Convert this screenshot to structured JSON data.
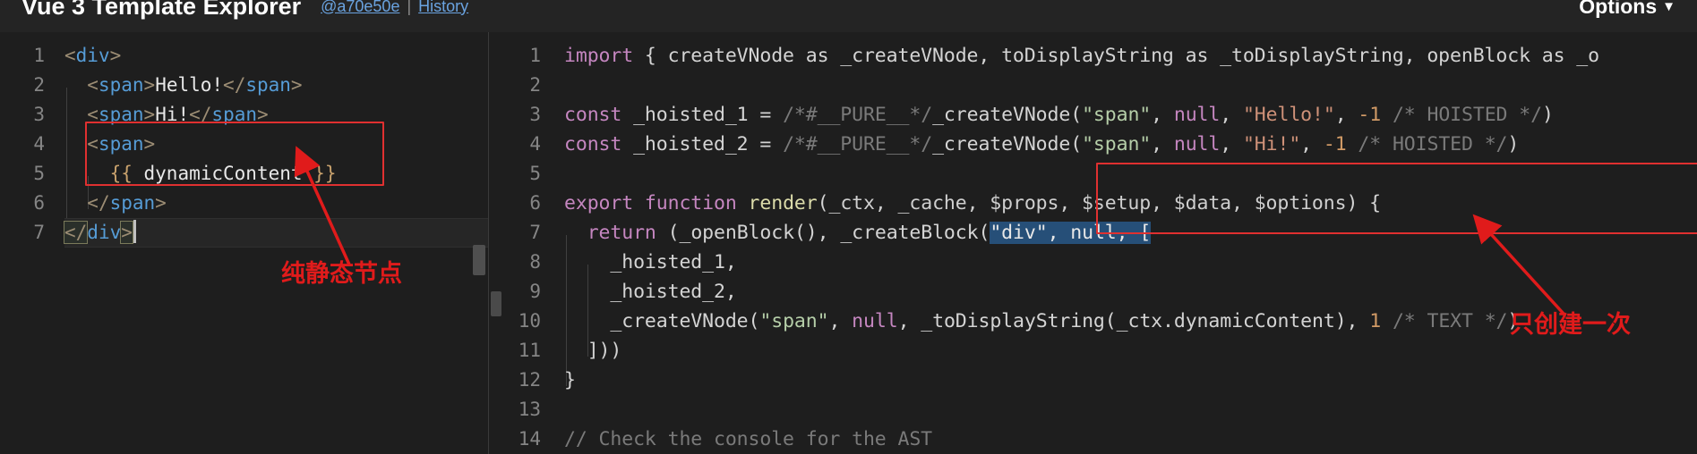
{
  "header": {
    "title": "Vue 3 Template Explorer",
    "commit_link": "@a70e50e",
    "separator": "|",
    "history_link": "History",
    "options_label": "Options",
    "options_caret": "▼"
  },
  "left_editor": {
    "name": "template-editor",
    "lines": [
      {
        "num": "1",
        "text": "<div>"
      },
      {
        "num": "2",
        "text": "  <span>Hello!</span>"
      },
      {
        "num": "3",
        "text": "  <span>Hi!</span>"
      },
      {
        "num": "4",
        "text": "  <span>"
      },
      {
        "num": "5",
        "text": "    {{ dynamicContent }}"
      },
      {
        "num": "6",
        "text": "  </span>"
      },
      {
        "num": "7",
        "text": "</div>"
      }
    ]
  },
  "right_editor": {
    "name": "output-editor",
    "lines": [
      {
        "num": "1",
        "text": "import { createVNode as _createVNode, toDisplayString as _toDisplayString, openBlock as _o"
      },
      {
        "num": "2",
        "text": ""
      },
      {
        "num": "3",
        "text": "const _hoisted_1 = /*#__PURE__*/_createVNode(\"span\", null, \"Hello!\", -1 /* HOISTED */)"
      },
      {
        "num": "4",
        "text": "const _hoisted_2 = /*#__PURE__*/_createVNode(\"span\", null, \"Hi!\", -1 /* HOISTED */)"
      },
      {
        "num": "5",
        "text": ""
      },
      {
        "num": "6",
        "text": "export function render(_ctx, _cache, $props, $setup, $data, $options) {"
      },
      {
        "num": "7",
        "text": "  return (_openBlock(), _createBlock(\"div\", null, ["
      },
      {
        "num": "8",
        "text": "    _hoisted_1,"
      },
      {
        "num": "9",
        "text": "    _hoisted_2,"
      },
      {
        "num": "10",
        "text": "    _createVNode(\"span\", null, _toDisplayString(_ctx.dynamicContent), 1 /* TEXT */)"
      },
      {
        "num": "11",
        "text": "  ]))"
      },
      {
        "num": "12",
        "text": "}"
      },
      {
        "num": "13",
        "text": ""
      },
      {
        "num": "14",
        "text": "// Check the console for the AST"
      }
    ]
  },
  "annotations": {
    "left_label": "纯静态节点",
    "right_label": "只创建一次",
    "highlight_color": "#e01b1b"
  },
  "tokens": {
    "l1_lt": "<",
    "l1_tag": "div",
    "l1_gt": ">",
    "l2_ind": "  ",
    "l2_lt": "<",
    "l2_tag": "span",
    "l2_gt": ">",
    "l2_txt": "Hello!",
    "l2_lt2": "</",
    "l2_tag2": "span",
    "l2_gt2": ">",
    "l3_ind": "  ",
    "l3_lt": "<",
    "l3_tag": "span",
    "l3_gt": ">",
    "l3_txt": "Hi!",
    "l3_lt2": "</",
    "l3_tag2": "span",
    "l3_gt2": ">",
    "l4_ind": "  ",
    "l4_lt": "<",
    "l4_tag": "span",
    "l4_gt": ">",
    "l5_ind": "    ",
    "l5_open": "{{",
    "l5_expr": " dynamicContent ",
    "l5_close": "}}",
    "l6_ind": "  ",
    "l6_lt": "</",
    "l6_tag": "span",
    "l6_gt": ">",
    "l7_lt": "</",
    "l7_tag": "div",
    "l7_gt": ">",
    "r1_kw": "import",
    "r1_rest": " { createVNode as _createVNode, toDisplayString as _toDisplayString, openBlock as _o",
    "r3_kw": "const",
    "r3_name": " _hoisted_1 ",
    "r3_eq": "= ",
    "r3_pure": "/*#__PURE__*/",
    "r3_fn": "_createVNode",
    "r3_p1": "(",
    "r3_s1": "\"span\"",
    "r3_c1": ", ",
    "r3_null": "null",
    "r3_c2": ", ",
    "r3_s2": "\"Hello!\"",
    "r3_c3": ", ",
    "r3_num": "-1",
    "r3_com": " /* HOISTED */",
    "r3_p2": ")",
    "r4_kw": "const",
    "r4_name": " _hoisted_2 ",
    "r4_eq": "= ",
    "r4_pure": "/*#__PURE__*/",
    "r4_fn": "_createVNode",
    "r4_p1": "(",
    "r4_s1": "\"span\"",
    "r4_c1": ", ",
    "r4_null": "null",
    "r4_c2": ", ",
    "r4_s2": "\"Hi!\"",
    "r4_c3": ", ",
    "r4_num": "-1",
    "r4_com": " /* HOISTED */",
    "r4_p2": ")",
    "r6_kw1": "export",
    "r6_kw2": " function",
    "r6_fn": " render",
    "r6_p1": "(",
    "r6_args": "_ctx, _cache, $props, $setup, $data, $options",
    "r6_p2": ")",
    "r6_brace": " {",
    "r7_ind": "  ",
    "r7_kw": "return",
    "r7_p1": " (",
    "r7_fn1": "_openBlock",
    "r7_p2": "(), ",
    "r7_fn2": "_createBlock",
    "r7_p3": "(",
    "r7_selA": "\"div\"",
    "r7_selB": ", ",
    "r7_selC": "null",
    "r7_selD": ", ",
    "r7_selE": "[",
    "r8_ind": "    ",
    "r8_txt": "_hoisted_1,",
    "r9_ind": "    ",
    "r9_txt": "_hoisted_2,",
    "r10_ind": "    ",
    "r10_fn": "_createVNode",
    "r10_p1": "(",
    "r10_s1": "\"span\"",
    "r10_c1": ", ",
    "r10_null": "null",
    "r10_c2": ", ",
    "r10_fn2": "_toDisplayString",
    "r10_p2": "(",
    "r10_expr": "_ctx.dynamicContent",
    "r10_p3": "), ",
    "r10_num": "1",
    "r10_com": " /* TEXT */",
    "r10_p4": ")",
    "r11_ind": "  ",
    "r11_txt": "]))",
    "r12_txt": "}",
    "r14_txt": "// Check the console for the AST"
  }
}
